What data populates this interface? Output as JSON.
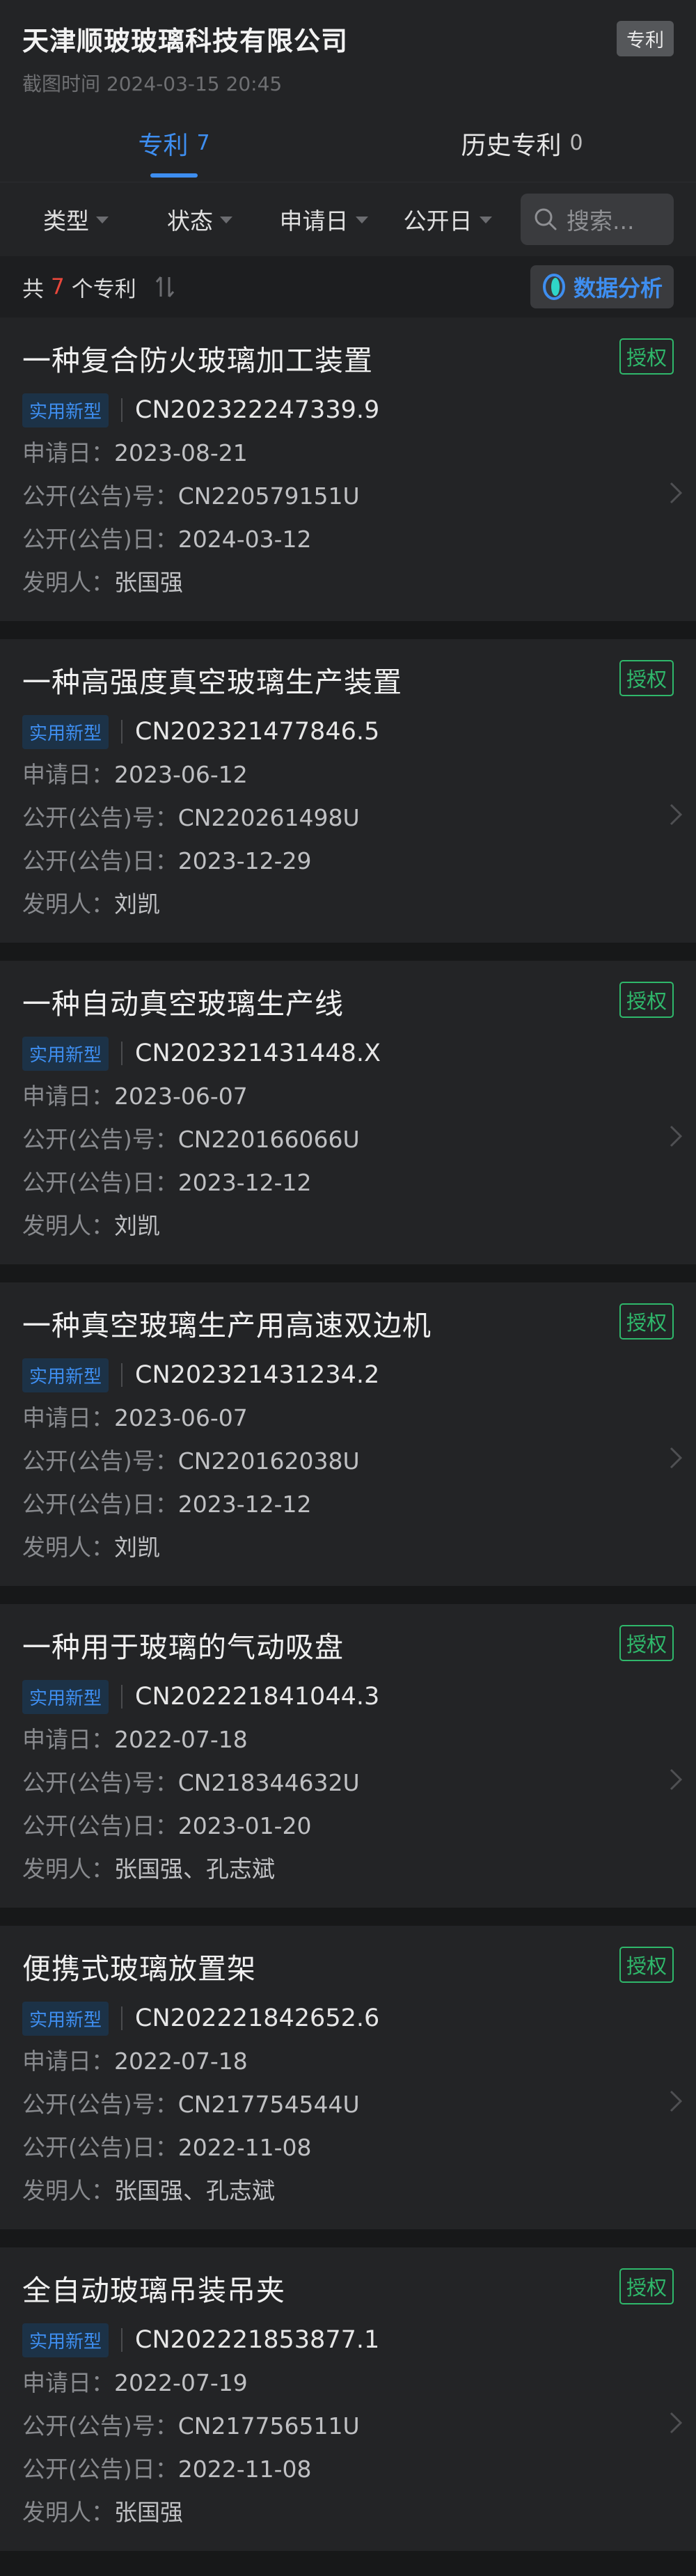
{
  "header": {
    "company": "天津顺玻玻璃科技有限公司",
    "screenshot_time": "截图时间 2024-03-15 20:45",
    "badge": "专利"
  },
  "tabs": [
    {
      "label": "专利",
      "count": "7",
      "active": true
    },
    {
      "label": "历史专利",
      "count": "0",
      "active": false
    }
  ],
  "filters": [
    "类型",
    "状态",
    "申请日",
    "公开日"
  ],
  "search": {
    "placeholder": "搜索..."
  },
  "summary": {
    "prefix": "共",
    "count": "7",
    "suffix": "个专利",
    "analysis": "数据分析"
  },
  "labels": {
    "apply_date": "申请日：",
    "pub_no": "公开(公告)号：",
    "pub_date": "公开(公告)日：",
    "inventor": "发明人："
  },
  "colors": {
    "accent": "#3e8ef0",
    "granted": "#2fb86b",
    "count_red": "#e8473b"
  },
  "patents": [
    {
      "title": "一种复合防火玻璃加工装置",
      "status": "授权",
      "type": "实用新型",
      "app_no": "CN202322247339.9",
      "apply_date": "2023-08-21",
      "pub_no": "CN220579151U",
      "pub_date": "2024-03-12",
      "inventor": "张国强"
    },
    {
      "title": "一种高强度真空玻璃生产装置",
      "status": "授权",
      "type": "实用新型",
      "app_no": "CN202321477846.5",
      "apply_date": "2023-06-12",
      "pub_no": "CN220261498U",
      "pub_date": "2023-12-29",
      "inventor": "刘凯"
    },
    {
      "title": "一种自动真空玻璃生产线",
      "status": "授权",
      "type": "实用新型",
      "app_no": "CN202321431448.X",
      "apply_date": "2023-06-07",
      "pub_no": "CN220166066U",
      "pub_date": "2023-12-12",
      "inventor": "刘凯"
    },
    {
      "title": "一种真空玻璃生产用高速双边机",
      "status": "授权",
      "type": "实用新型",
      "app_no": "CN202321431234.2",
      "apply_date": "2023-06-07",
      "pub_no": "CN220162038U",
      "pub_date": "2023-12-12",
      "inventor": "刘凯"
    },
    {
      "title": "一种用于玻璃的气动吸盘",
      "status": "授权",
      "type": "实用新型",
      "app_no": "CN202221841044.3",
      "apply_date": "2022-07-18",
      "pub_no": "CN218344632U",
      "pub_date": "2023-01-20",
      "inventor": "张国强、孔志斌"
    },
    {
      "title": "便携式玻璃放置架",
      "status": "授权",
      "type": "实用新型",
      "app_no": "CN202221842652.6",
      "apply_date": "2022-07-18",
      "pub_no": "CN217754544U",
      "pub_date": "2022-11-08",
      "inventor": "张国强、孔志斌"
    },
    {
      "title": "全自动玻璃吊装吊夹",
      "status": "授权",
      "type": "实用新型",
      "app_no": "CN202221853877.1",
      "apply_date": "2022-07-19",
      "pub_no": "CN217756511U",
      "pub_date": "2022-11-08",
      "inventor": "张国强"
    }
  ]
}
